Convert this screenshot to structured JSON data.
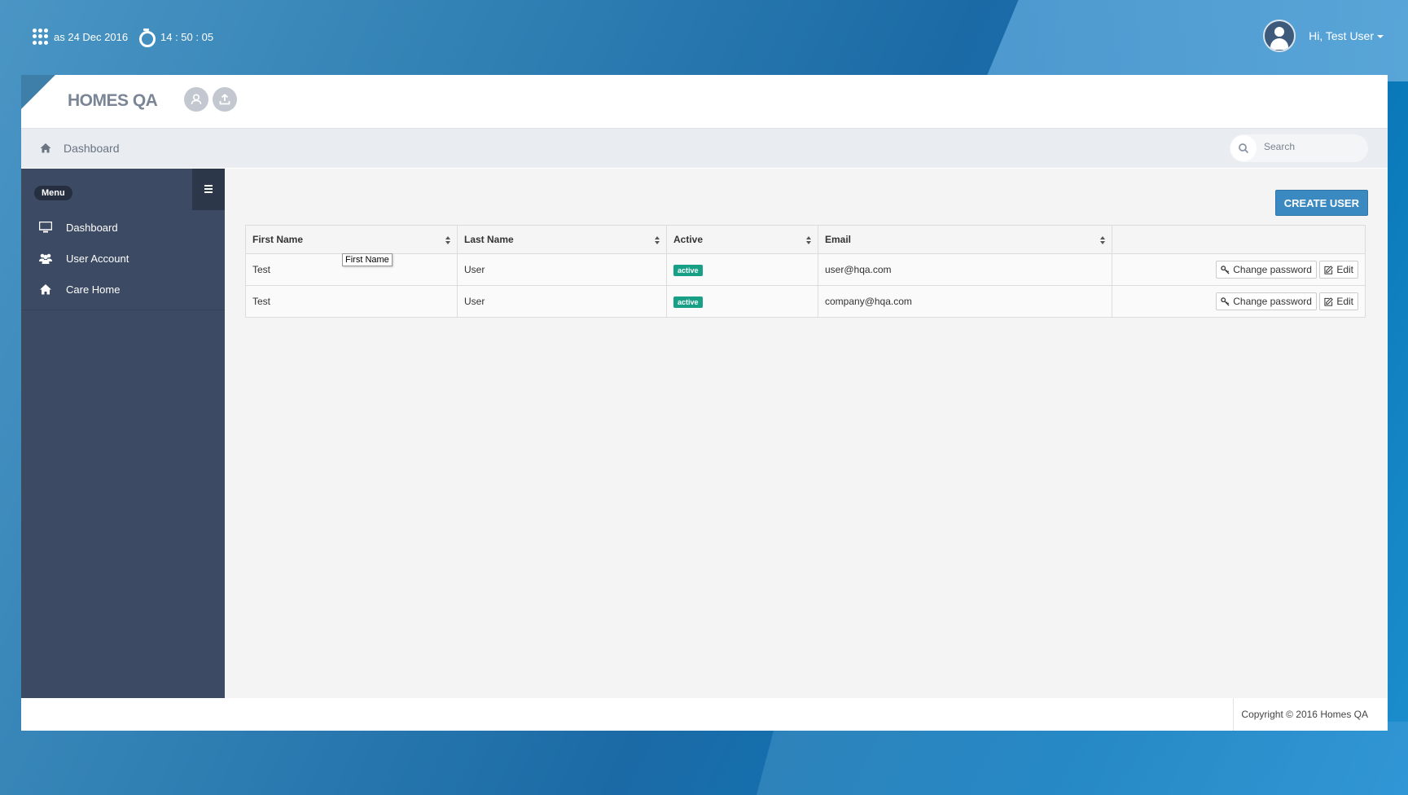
{
  "topbar": {
    "date_text": "as 24 Dec 2016",
    "time_text": "14 : 50 : 05",
    "greeting": "Hi, Test User"
  },
  "brand": {
    "name": "HOMES QA"
  },
  "breadcrumb": {
    "current": "Dashboard"
  },
  "search": {
    "placeholder": "Search"
  },
  "sidebar": {
    "menu_label": "Menu",
    "items": [
      {
        "label": "Dashboard",
        "icon": "monitor-icon"
      },
      {
        "label": "User Account",
        "icon": "users-icon"
      },
      {
        "label": "Care Home",
        "icon": "home-icon"
      }
    ]
  },
  "main": {
    "create_button": "CREATE USER",
    "table": {
      "headers": [
        "First Name",
        "Last Name",
        "Active",
        "Email"
      ],
      "rows": [
        {
          "first_name": "Test",
          "last_name": "User",
          "status": "active",
          "email": "user@hqa.com",
          "change_password": "Change password",
          "edit": "Edit"
        },
        {
          "first_name": "Test",
          "last_name": "User",
          "status": "active",
          "email": "company@hqa.com",
          "change_password": "Change password",
          "edit": "Edit"
        }
      ]
    },
    "tooltip": "First Name"
  },
  "footer": {
    "copyright": "Copyright © 2016 Homes QA"
  },
  "colors": {
    "accent": "#3a8ac1",
    "sidebar": "#3c4a63",
    "badge_active": "#17a085"
  }
}
